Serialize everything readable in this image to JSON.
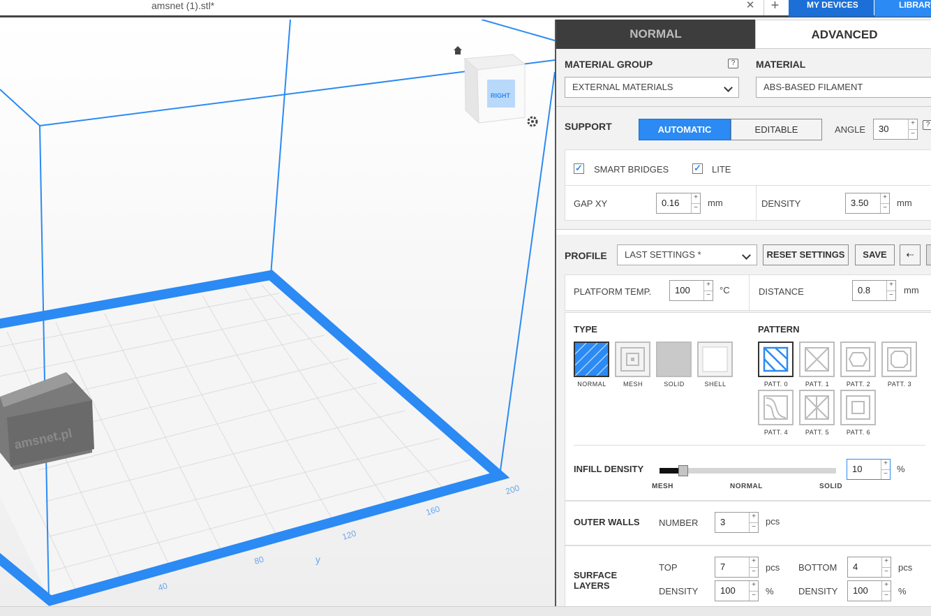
{
  "topbar": {
    "file_tab": "amsnet (1).stl*",
    "close_glyph": "✕",
    "add_glyph": "+",
    "my_devices": "MY DEVICES",
    "library": "LIBRARY"
  },
  "viewport": {
    "view_cube_label": "RIGHT",
    "axis_label_y": "y",
    "y_ticks": [
      "40",
      "80",
      "120",
      "160",
      "200"
    ],
    "model_text": "amsnet.pl",
    "colors": {
      "frame": "#2b8af3",
      "grid": "#d9d9d9",
      "model": "#6b6b6b"
    }
  },
  "panel": {
    "tabs": {
      "normal": "NORMAL",
      "advanced": "ADVANCED"
    },
    "material_group": {
      "label": "MATERIAL GROUP",
      "help": "?",
      "value": "EXTERNAL MATERIALS"
    },
    "material": {
      "label": "MATERIAL",
      "value": "ABS-BASED FILAMENT"
    },
    "support": {
      "label": "SUPPORT",
      "automatic": "AUTOMATIC",
      "editable": "EDITABLE",
      "angle_label": "ANGLE",
      "angle_value": "30",
      "help": "?",
      "smart_bridges": "SMART BRIDGES",
      "lite": "LITE",
      "gap_label": "GAP XY",
      "gap_value": "0.16",
      "gap_unit": "mm",
      "density_label": "DENSITY",
      "density_value": "3.50",
      "density_unit": "mm"
    },
    "profile": {
      "label": "PROFILE",
      "value": "LAST SETTINGS *",
      "reset": "RESET SETTINGS",
      "save": "SAVE",
      "icon_glyph": "⇠"
    },
    "platform": {
      "temp_label": "PLATFORM TEMP.",
      "temp_value": "100",
      "temp_unit": "°C",
      "distance_label": "DISTANCE",
      "distance_value": "0.8",
      "distance_unit": "mm"
    },
    "infill": {
      "type_label": "TYPE",
      "types": [
        "NORMAL",
        "MESH",
        "SOLID",
        "SHELL"
      ],
      "pattern_label": "PATTERN",
      "patterns": [
        "PATT. 0",
        "PATT. 1",
        "PATT. 2",
        "PATT. 3",
        "PATT. 4",
        "PATT. 5",
        "PATT. 6"
      ],
      "density_label": "INFILL DENSITY",
      "density_value": "10",
      "density_unit": "%",
      "density_fraction": 0.1,
      "scale": {
        "mesh": "MESH",
        "normal": "NORMAL",
        "solid": "SOLID"
      }
    },
    "outer_walls": {
      "label": "OUTER WALLS",
      "number_label": "NUMBER",
      "number_value": "3",
      "unit": "pcs"
    },
    "surface_layers": {
      "label_line1": "SURFACE",
      "label_line2": "LAYERS",
      "top_label": "TOP",
      "top_value": "7",
      "top_unit": "pcs",
      "bottom_label": "BOTTOM",
      "bottom_value": "4",
      "bottom_unit": "pcs",
      "top_density_label": "DENSITY",
      "top_density_value": "100",
      "top_density_unit": "%",
      "bottom_density_label": "DENSITY",
      "bottom_density_value": "100",
      "bottom_density_unit": "%"
    }
  }
}
